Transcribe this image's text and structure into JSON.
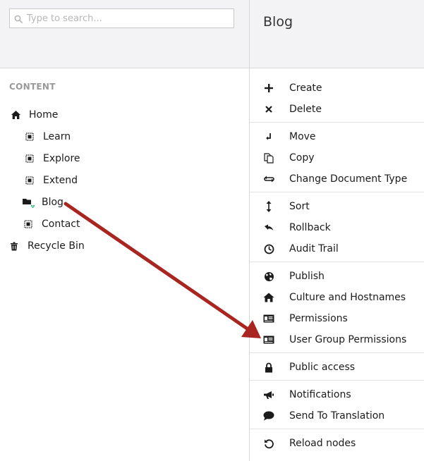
{
  "search": {
    "placeholder": "Type to search..."
  },
  "tree": {
    "section_label": "CONTENT",
    "items": [
      {
        "label": "Home",
        "icon": "home-icon"
      },
      {
        "label": "Learn",
        "icon": "document-icon"
      },
      {
        "label": "Explore",
        "icon": "document-icon"
      },
      {
        "label": "Extend",
        "icon": "document-icon"
      },
      {
        "label": "Blog",
        "icon": "folder-icon"
      },
      {
        "label": "Contact",
        "icon": "document-icon"
      },
      {
        "label": "Recycle Bin",
        "icon": "trash-icon"
      }
    ]
  },
  "actions": {
    "title": "Blog",
    "groups": [
      [
        {
          "label": "Create",
          "icon": "plus-icon"
        },
        {
          "label": "Delete",
          "icon": "x-icon"
        }
      ],
      [
        {
          "label": "Move",
          "icon": "move-icon"
        },
        {
          "label": "Copy",
          "icon": "copy-icon"
        },
        {
          "label": "Change Document Type",
          "icon": "swap-icon"
        }
      ],
      [
        {
          "label": "Sort",
          "icon": "sort-icon"
        },
        {
          "label": "Rollback",
          "icon": "undo-icon"
        },
        {
          "label": "Audit Trail",
          "icon": "clock-icon"
        }
      ],
      [
        {
          "label": "Publish",
          "icon": "globe-icon"
        },
        {
          "label": "Culture and Hostnames",
          "icon": "home-icon"
        },
        {
          "label": "Permissions",
          "icon": "id-card-icon"
        },
        {
          "label": "User Group Permissions",
          "icon": "id-card-icon"
        }
      ],
      [
        {
          "label": "Public access",
          "icon": "lock-icon"
        }
      ],
      [
        {
          "label": "Notifications",
          "icon": "megaphone-icon"
        },
        {
          "label": "Send To Translation",
          "icon": "speech-bubble-icon"
        }
      ],
      [
        {
          "label": "Reload nodes",
          "icon": "reload-icon"
        }
      ]
    ]
  },
  "colors": {
    "arrow": "#a82520",
    "header_bg": "#f3f3f5",
    "divider": "#d8d7d9",
    "muted_text": "#999999"
  }
}
